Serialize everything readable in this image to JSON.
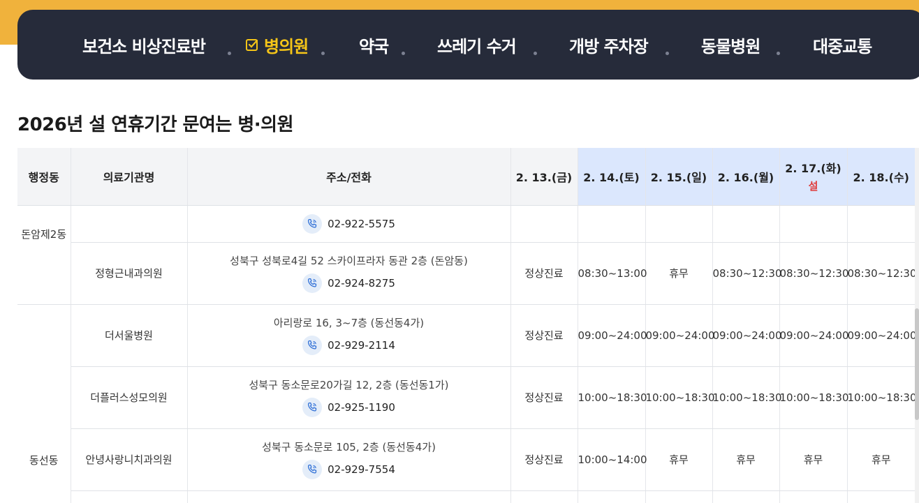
{
  "nav": {
    "items": [
      {
        "label": "보건소 비상진료반",
        "active": false
      },
      {
        "label": "병의원",
        "active": true
      },
      {
        "label": "약국",
        "active": false
      },
      {
        "label": "쓰레기 수거",
        "active": false
      },
      {
        "label": "개방 주차장",
        "active": false
      },
      {
        "label": "동물병원",
        "active": false
      },
      {
        "label": "대중교통",
        "active": false
      }
    ]
  },
  "page_title": "2026년 설 연휴기간 문여는 병·의원",
  "table": {
    "headers": [
      "행정동",
      "의료기관명",
      "주소/전화",
      "2. 13.(금)",
      "2. 14.(토)",
      "2. 15.(일)",
      "2. 16.(월)",
      "2. 17.(화)",
      "2. 18.(수)"
    ],
    "holiday_note": "설",
    "rows": [
      {
        "dong": "돈암제2동",
        "name": "",
        "address": "",
        "phone": "02-922-5575",
        "d13": "",
        "d14": "",
        "d15": "",
        "d16": "",
        "d17": "",
        "d18": ""
      },
      {
        "dong": "",
        "name": "정형근내과의원",
        "address": "성북구 성북로4길 52 스카이프라자 동관 2층 (돈암동)",
        "phone": "02-924-8275",
        "d13": "정상진료",
        "d14": "08:30~13:00",
        "d15": "휴무",
        "d16": "08:30~12:30",
        "d17": "08:30~12:30",
        "d18": "08:30~12:30"
      },
      {
        "dong": "",
        "name": "더서울병원",
        "address": "아리랑로 16, 3~7층 (동선동4가)",
        "phone": "02-929-2114",
        "d13": "정상진료",
        "d14": "09:00~24:00",
        "d15": "09:00~24:00",
        "d16": "09:00~24:00",
        "d17": "09:00~24:00",
        "d18": "09:00~24:00"
      },
      {
        "dong": "",
        "name": "더플러스성모의원",
        "address": "성북구 동소문로20가길 12, 2층 (동선동1가)",
        "phone": "02-925-1190",
        "d13": "정상진료",
        "d14": "10:00~18:30",
        "d15": "10:00~18:30",
        "d16": "10:00~18:30",
        "d17": "10:00~18:30",
        "d18": "10:00~18:30"
      },
      {
        "dong": "동선동",
        "name": "안녕사랑니치과의원",
        "address": "성북구 동소문로 105, 2층 (동선동4가)",
        "phone": "02-929-7554",
        "d13": "정상진료",
        "d14": "10:00~14:00",
        "d15": "휴무",
        "d16": "휴무",
        "d17": "휴무",
        "d18": "휴무"
      }
    ]
  }
}
